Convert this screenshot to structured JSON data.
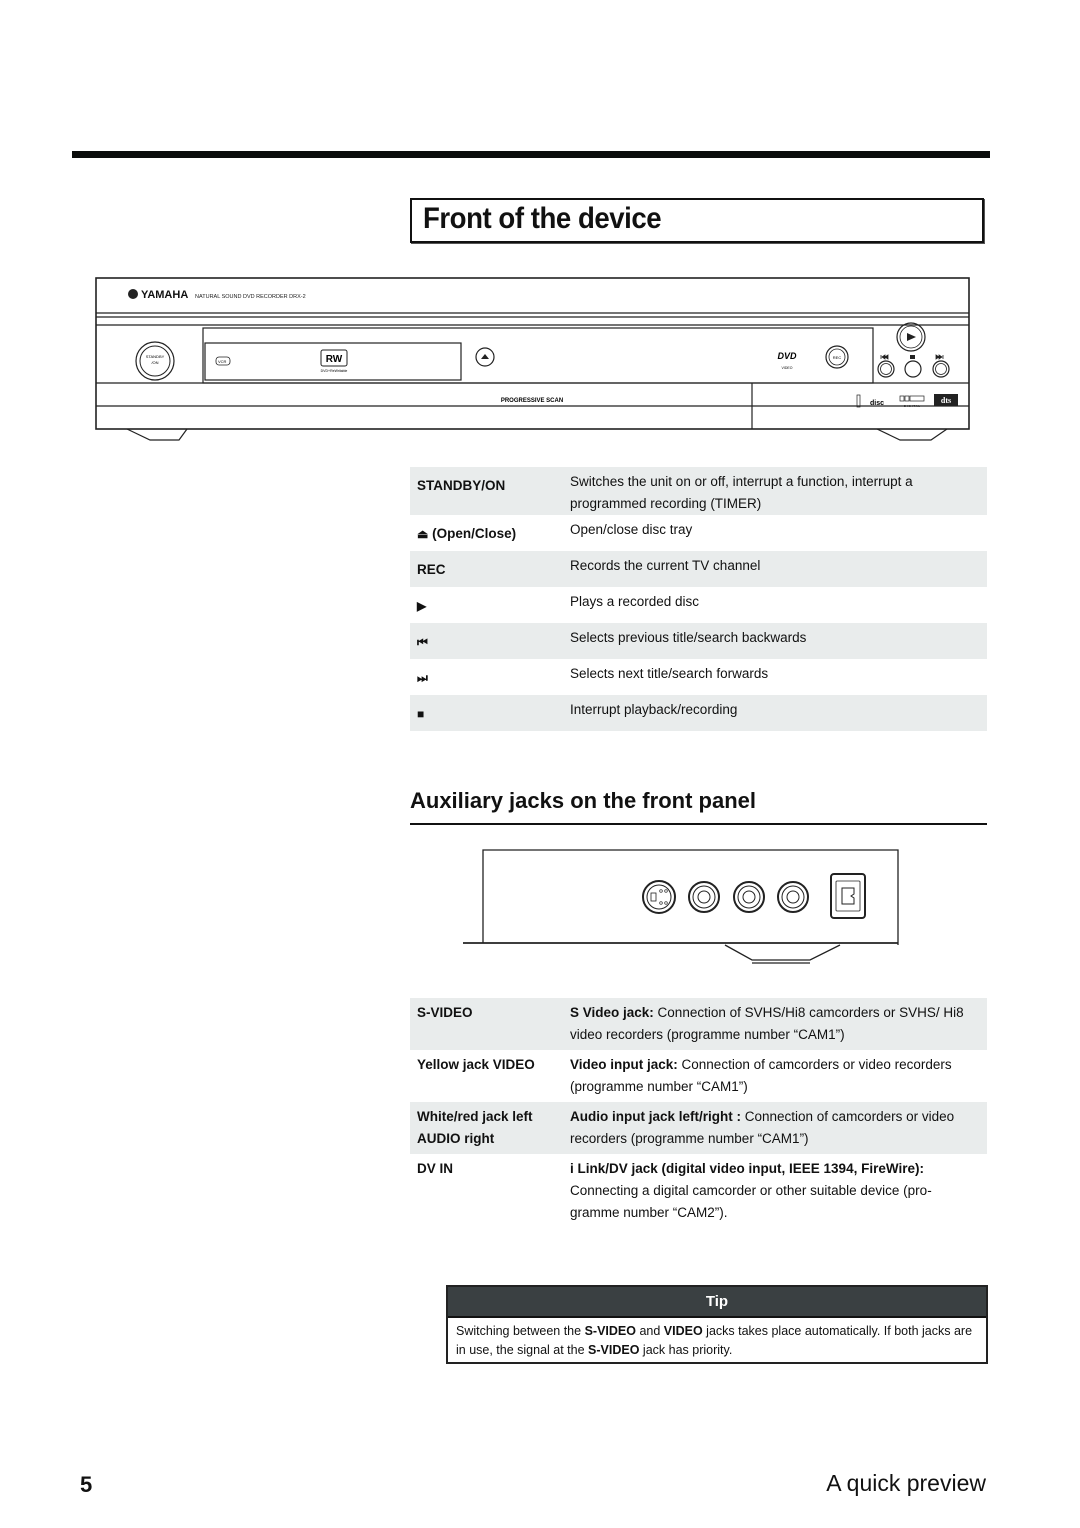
{
  "page": {
    "title": "Front of the device",
    "section2_title": "Auxiliary jacks on the front panel",
    "page_number": "5",
    "section_name": "A quick preview"
  },
  "device": {
    "brand": "YAMAHA",
    "model_line": "NATURAL SOUND DVD RECORDER  DRX-2",
    "standby_label_1": "STANDBY",
    "standby_label_2": "/ON",
    "rw_logo": "RW",
    "rw_caption": "DVD+ReWritable",
    "vcr_logo": "VCR",
    "progressive_scan": "PROGRESSIVE SCAN",
    "dvd_logo": "DVD",
    "dvd_caption": "VIDEO",
    "rec_label": "REC",
    "dolby_label": "DOLBY",
    "digital_label": "D I G I T A L",
    "dts_label": "dts",
    "disc_label": "disc"
  },
  "front_controls": [
    {
      "glyph": "",
      "key": "STANDBY/ON",
      "desc": "Switches the unit on or off, interrupt a function, interrupt a programmed recording (TIMER)",
      "shaded": true
    },
    {
      "glyph": "⏏",
      "key": " (Open/Close)",
      "desc": "Open/close disc tray",
      "shaded": false
    },
    {
      "glyph": "",
      "key": "REC",
      "desc": "Records the current TV channel",
      "shaded": true
    },
    {
      "glyph": "▶",
      "key": "",
      "desc": "Plays a recorded disc",
      "shaded": false
    },
    {
      "glyph": "⏮",
      "key": "",
      "desc": "Selects previous title/search backwards",
      "shaded": true
    },
    {
      "glyph": "⏭",
      "key": "",
      "desc": "Selects next title/search forwards",
      "shaded": false
    },
    {
      "glyph": "■",
      "key": "",
      "desc": "Interrupt playback/recording",
      "shaded": true
    }
  ],
  "aux_jacks": [
    {
      "key": "S-VIDEO",
      "desc_bold": "S Video jack:",
      "desc": " Connection of SVHS/Hi8 camcorders or SVHS/ Hi8 video recorders (programme number “CAM1”)",
      "shaded": true
    },
    {
      "key": "Yellow jack VIDEO",
      "desc_bold": "Video input jack:",
      "desc": " Connection of camcorders or video recorders (programme number “CAM1”)",
      "shaded": false
    },
    {
      "key": "White/red jack left AUDIO right",
      "desc_bold": "Audio input jack left/right :",
      "desc": " Connection of camcorders or video recorders (programme number “CAM1”)",
      "shaded": true
    },
    {
      "key": "DV IN",
      "desc_bold": "i Link/DV jack (digital video input, IEEE 1394, FireWire):",
      "desc": "Connecting a digital camcorder or other suitable device (pro- gramme number “CAM2”).",
      "shaded": false,
      "desc_newline": true
    }
  ],
  "tip": {
    "heading": "Tip",
    "parts": [
      {
        "text": "Switching between the ",
        "bold": false
      },
      {
        "text": "S-VIDEO",
        "bold": true
      },
      {
        "text": " and ",
        "bold": false
      },
      {
        "text": "VIDEO",
        "bold": true
      },
      {
        "text": " jacks takes place automatically. If both jacks are in use, the signal at the ",
        "bold": false
      },
      {
        "text": "S-VIDEO",
        "bold": true
      },
      {
        "text": " jack has priority.",
        "bold": false
      }
    ]
  },
  "colors": {
    "row_shade": "#e9ecec",
    "tip_header": "#3a4042",
    "rule": "#0a0c0b"
  }
}
